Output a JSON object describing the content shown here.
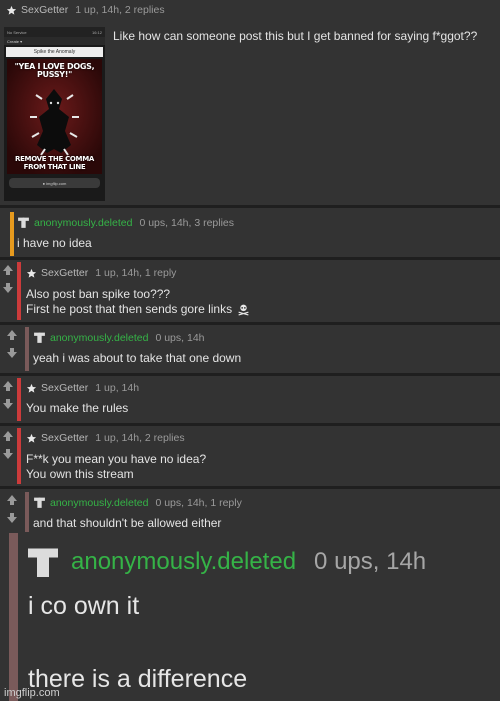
{
  "comments": [
    {
      "user": "SexGetter",
      "meta": "1 up, 14h, 2 replies",
      "lines": [
        "Like how can someone post this but I get banned for saying f*ggot??"
      ],
      "image": {
        "status_left": "No Service",
        "status_right": "16:12",
        "toolbar": "Create ▾",
        "title": "Spike the Anomaly",
        "caption_top": "\"YEA I LOVE DOGS, PUSSY!\"",
        "caption_bottom": "REMOVE THE COMMA FROM THAT LINE",
        "url": "● imgflip.com"
      }
    },
    {
      "user": "anonymously.deleted",
      "meta": "0 ups, 14h, 3 replies",
      "lines": [
        "i have no idea"
      ]
    },
    {
      "user": "SexGetter",
      "meta": "1 up, 14h, 1 reply",
      "lines": [
        "Also post ban spike too???",
        "First he post that then sends gore links"
      ]
    },
    {
      "user": "anonymously.deleted",
      "meta": "0 ups, 14h",
      "lines": [
        "yeah i was about to take that one down"
      ]
    },
    {
      "user": "SexGetter",
      "meta": "1 up, 14h",
      "lines": [
        "You make the rules"
      ]
    },
    {
      "user": "SexGetter",
      "meta": "1 up, 14h, 2 replies",
      "lines": [
        "F**k you mean you have no idea?",
        "You own this stream"
      ]
    },
    {
      "user": "anonymously.deleted",
      "meta": "0 ups, 14h, 1 reply",
      "lines": [
        "and that shouldn't be allowed either"
      ]
    },
    {
      "user": "anonymously.deleted",
      "meta": "0 ups, 14h",
      "lines": [
        "i co own it",
        "there is a difference"
      ]
    }
  ],
  "watermark": "imgflip.com",
  "colors": {
    "background": "#333333",
    "green_user": "#35b347",
    "red_bar": "#cc3b3b",
    "orange_bar": "#e69a1e"
  },
  "icons": [
    "star-icon",
    "user-silhouette-icon",
    "upvote-arrow-icon",
    "downvote-arrow-icon",
    "skull-crossbones-icon"
  ]
}
